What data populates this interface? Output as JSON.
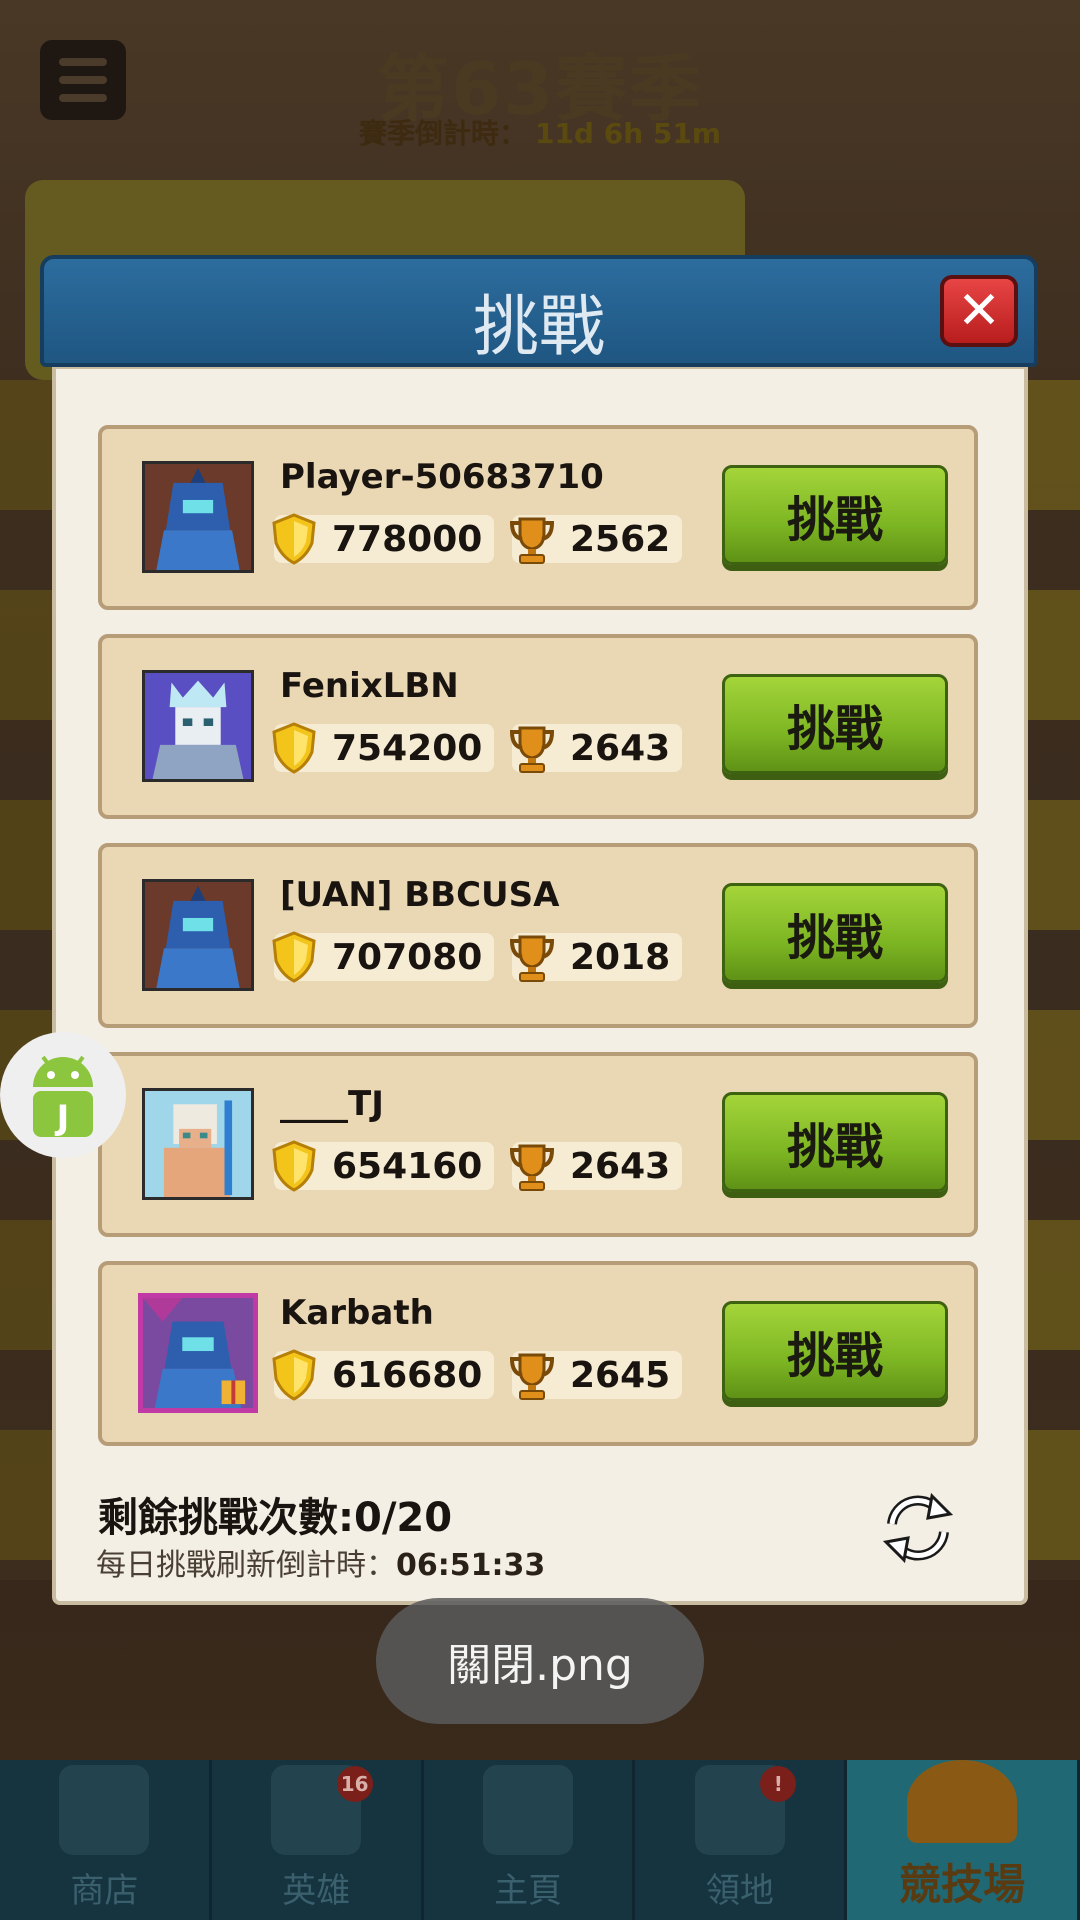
{
  "season": {
    "title": "第63賽季",
    "countdown_label": "賽季倒計時：",
    "countdown_value": "11d 6h 51m"
  },
  "dialog": {
    "title": "挑戰",
    "close_symbol": "✕"
  },
  "opponents": [
    {
      "name": "Player-50683710",
      "score": "778000",
      "trophies": "2562",
      "button": "挑戰",
      "avatar": "blue-knight"
    },
    {
      "name": "FenixLBN",
      "score": "754200",
      "trophies": "2643",
      "button": "挑戰",
      "avatar": "skeleton-king"
    },
    {
      "name": "[UAN] BBCUSA",
      "score": "707080",
      "trophies": "2018",
      "button": "挑戰",
      "avatar": "blue-knight"
    },
    {
      "name": "____TJ",
      "score": "654160",
      "trophies": "2643",
      "button": "挑戰",
      "avatar": "white-warrior"
    },
    {
      "name": "Karbath",
      "score": "616680",
      "trophies": "2645",
      "button": "挑戰",
      "avatar": "blue-knight-gift"
    }
  ],
  "footer": {
    "remaining_label": "剩餘挑戰次數:0/20",
    "refresh_label": "每日挑戰刷新倒計時：",
    "refresh_value": "06:51:33"
  },
  "toast": {
    "text": "關閉.png"
  },
  "nav": [
    {
      "label": "商店",
      "badge": ""
    },
    {
      "label": "英雄",
      "badge": "16"
    },
    {
      "label": "主頁",
      "badge": ""
    },
    {
      "label": "領地",
      "badge": "!"
    },
    {
      "label": "競技場",
      "badge": ""
    }
  ],
  "colors": {
    "header_blue": "#1f5682",
    "challenge_green": "#7db623",
    "close_red": "#d02a2a",
    "card_tan": "#ead8b5"
  }
}
